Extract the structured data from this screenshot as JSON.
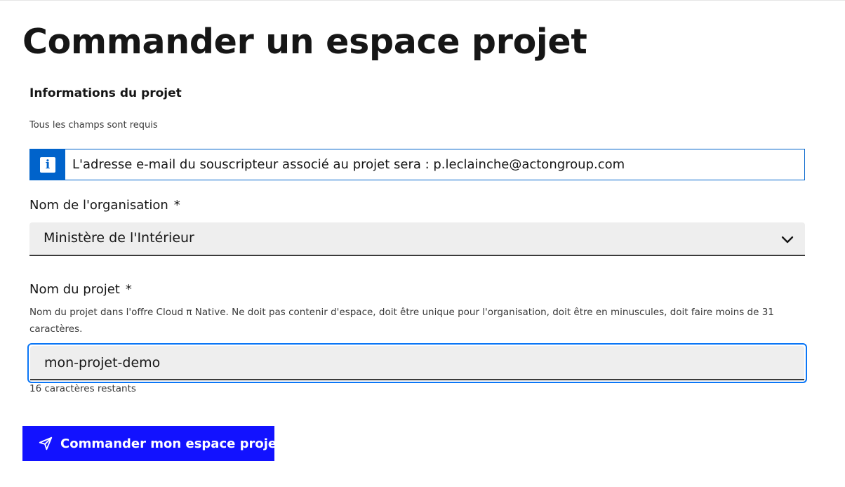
{
  "page": {
    "title": "Commander un espace projet"
  },
  "section": {
    "title": "Informations du projet",
    "required_note": "Tous les champs sont requis"
  },
  "alert": {
    "icon": "info-icon",
    "icon_glyph": "i",
    "message": "L'adresse e-mail du souscripteur associé au projet sera : p.leclainche@actongroup.com"
  },
  "organisation": {
    "label": "Nom de l'organisation",
    "required_mark": "*",
    "selected_value": "Ministère de l'Intérieur"
  },
  "project": {
    "label": "Nom du projet",
    "required_mark": "*",
    "hint": "Nom du projet dans l'offre Cloud π Native. Ne doit pas contenir d'espace, doit être unique pour l'organisation, doit être en minuscules, doit faire moins de 31 caractères.",
    "value": "mon-projet-demo",
    "counter": "16 caractères restants"
  },
  "submit": {
    "label": "Commander mon espace projet",
    "icon": "send-icon"
  },
  "colors": {
    "primary": "#1212ff",
    "info": "#0063cb",
    "focus": "#0a76f6",
    "field_bg": "#eeeeee"
  }
}
